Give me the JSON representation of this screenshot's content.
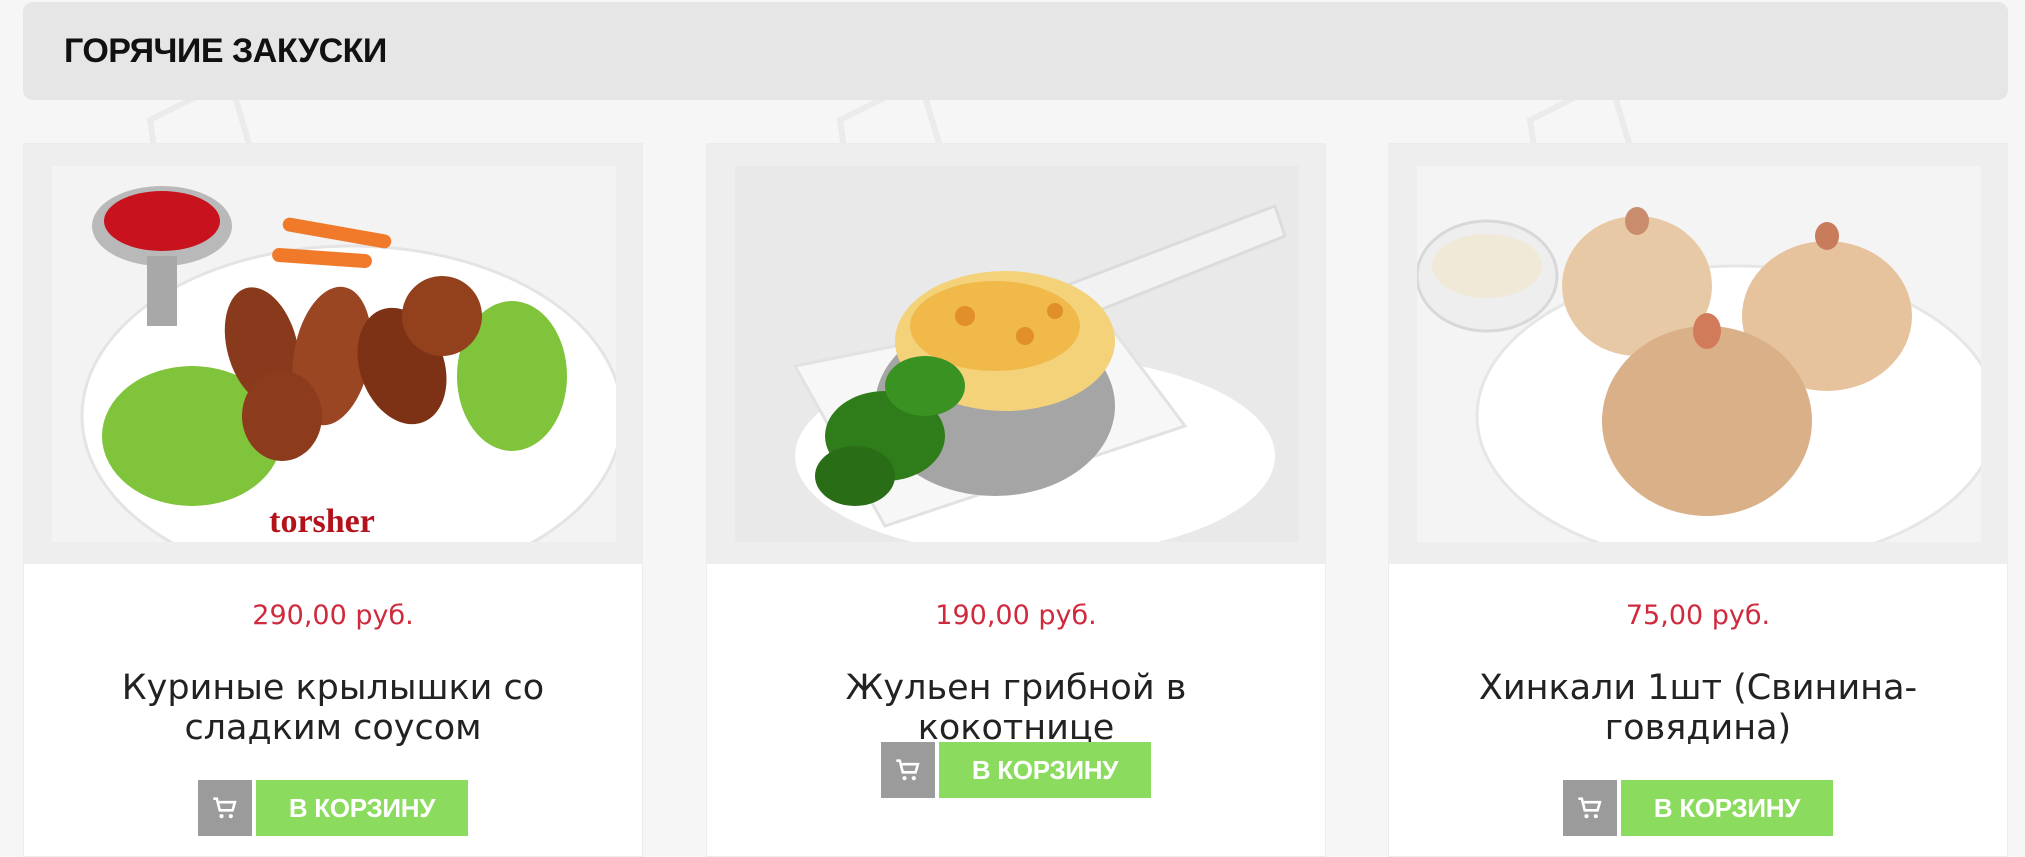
{
  "section": {
    "title": "ГОРЯЧИЕ ЗАКУСКИ"
  },
  "products": [
    {
      "price": "290,00 руб.",
      "name": "Куриные крылышки со сладким соусом",
      "add_label": "В КОРЗИНУ",
      "image_caption": "torsher"
    },
    {
      "price": "190,00 руб.",
      "name": "Жульен грибной в кокотнице",
      "add_label": "В КОРЗИНУ"
    },
    {
      "price": "75,00 руб.",
      "name": "Хинкали 1шт (Свинина-говядина)",
      "add_label": "В КОРЗИНУ"
    }
  ],
  "colors": {
    "price": "#cf2a3d",
    "add_button": "#8bdc5e",
    "cart_button": "#9b9b9b",
    "header_bg": "#e6e6e6"
  },
  "icons": {
    "cart": "shopping-cart-icon"
  }
}
